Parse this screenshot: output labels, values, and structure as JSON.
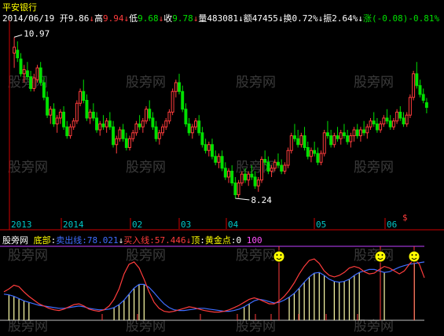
{
  "stock_name": "平安银行",
  "info": {
    "date": "2014/06/19",
    "open_label": "开",
    "open": "9.86",
    "high_label": "高",
    "high": "9.94",
    "low_label": "低",
    "low": "9.68",
    "close_label": "收",
    "close": "9.78",
    "vol_label": "量",
    "vol": "483081",
    "amt_label": "额",
    "amt": "47455",
    "turnover_label": "换",
    "turnover": "0.72%",
    "amp_label": "振",
    "amp": "2.64%",
    "change_label": "涨",
    "change": "(-0.08)",
    "change_pct": "-0.81%"
  },
  "annotations": {
    "max_price": "10.97",
    "min_price": "8.24",
    "marker": "$"
  },
  "time_labels": [
    "2013",
    "2014",
    "02",
    "03",
    "04",
    "05",
    "06"
  ],
  "watermark": "股旁网",
  "indicator": {
    "name": "股旁网",
    "bottom_label": "底部",
    "sell_label": "卖出线",
    "sell_value": "78.021",
    "buy_label": "买入线",
    "buy_value": "57.446",
    "top_label": "顶",
    "gold_label": "黄金点",
    "gold_value": "0",
    "hundred": "100"
  },
  "colors": {
    "up": "#ff3c3c",
    "down": "#00e000",
    "axis": "#d00000",
    "grid": "#7a0000",
    "sell": "#3f6dff",
    "buy": "#ff3c3c"
  },
  "chart_data": [
    {
      "type": "candlestick",
      "title": "平安银行",
      "x_labels": [
        "2013",
        "2014",
        "02",
        "03",
        "04",
        "05",
        "06"
      ],
      "annotations": [
        {
          "label": "10.97",
          "kind": "high"
        },
        {
          "label": "8.24",
          "kind": "low"
        }
      ],
      "ylim": [
        8.0,
        11.2
      ],
      "candles": [
        [
          10.7,
          10.97,
          10.45,
          10.8
        ],
        [
          10.75,
          10.9,
          10.55,
          10.62
        ],
        [
          10.6,
          10.7,
          10.3,
          10.35
        ],
        [
          10.35,
          10.5,
          10.2,
          10.42
        ],
        [
          10.4,
          10.55,
          10.25,
          10.3
        ],
        [
          10.3,
          10.4,
          10.05,
          10.1
        ],
        [
          10.1,
          10.35,
          10.05,
          10.28
        ],
        [
          10.25,
          10.5,
          10.2,
          10.45
        ],
        [
          10.45,
          10.55,
          10.15,
          10.2
        ],
        [
          10.2,
          10.3,
          9.9,
          9.95
        ],
        [
          9.95,
          10.05,
          9.6,
          9.65
        ],
        [
          9.65,
          9.8,
          9.5,
          9.75
        ],
        [
          9.75,
          9.85,
          9.45,
          9.5
        ],
        [
          9.5,
          9.65,
          9.35,
          9.6
        ],
        [
          9.6,
          9.75,
          9.5,
          9.7
        ],
        [
          9.7,
          9.8,
          9.4,
          9.45
        ],
        [
          9.45,
          9.55,
          9.25,
          9.3
        ],
        [
          9.3,
          9.5,
          9.25,
          9.45
        ],
        [
          9.45,
          9.6,
          9.4,
          9.55
        ],
        [
          9.55,
          9.9,
          9.5,
          9.85
        ],
        [
          9.85,
          10.1,
          9.8,
          10.05
        ],
        [
          10.05,
          10.25,
          9.85,
          9.9
        ],
        [
          9.9,
          10.0,
          9.55,
          9.6
        ],
        [
          9.6,
          9.75,
          9.5,
          9.7
        ],
        [
          9.7,
          9.85,
          9.55,
          9.6
        ],
        [
          9.6,
          9.7,
          9.35,
          9.4
        ],
        [
          9.4,
          9.55,
          9.3,
          9.5
        ],
        [
          9.5,
          9.65,
          9.4,
          9.45
        ],
        [
          9.45,
          9.6,
          9.35,
          9.55
        ],
        [
          9.55,
          9.7,
          9.4,
          9.45
        ],
        [
          9.45,
          9.55,
          9.1,
          9.15
        ],
        [
          9.15,
          9.3,
          9.0,
          9.25
        ],
        [
          9.25,
          9.45,
          9.2,
          9.4
        ],
        [
          9.4,
          9.5,
          9.2,
          9.25
        ],
        [
          9.25,
          9.35,
          9.05,
          9.1
        ],
        [
          9.1,
          9.3,
          9.05,
          9.25
        ],
        [
          9.25,
          9.4,
          9.2,
          9.35
        ],
        [
          9.35,
          9.55,
          9.3,
          9.5
        ],
        [
          9.5,
          9.65,
          9.4,
          9.45
        ],
        [
          9.45,
          9.6,
          9.35,
          9.55
        ],
        [
          9.55,
          9.8,
          9.5,
          9.75
        ],
        [
          9.75,
          9.9,
          9.55,
          9.6
        ],
        [
          9.6,
          9.7,
          9.4,
          9.45
        ],
        [
          9.45,
          9.55,
          9.2,
          9.25
        ],
        [
          9.25,
          9.4,
          9.15,
          9.35
        ],
        [
          9.35,
          9.5,
          9.3,
          9.45
        ],
        [
          9.45,
          9.6,
          9.4,
          9.55
        ],
        [
          9.55,
          9.75,
          9.5,
          9.7
        ],
        [
          9.7,
          10.1,
          9.65,
          10.05
        ],
        [
          10.05,
          10.25,
          9.95,
          10.2
        ],
        [
          10.2,
          10.35,
          10.0,
          10.05
        ],
        [
          10.05,
          10.15,
          9.7,
          9.75
        ],
        [
          9.75,
          9.85,
          9.45,
          9.5
        ],
        [
          9.5,
          9.6,
          9.3,
          9.35
        ],
        [
          9.35,
          9.5,
          9.25,
          9.45
        ],
        [
          9.45,
          9.6,
          9.4,
          9.55
        ],
        [
          9.55,
          9.65,
          9.3,
          9.35
        ],
        [
          9.35,
          9.45,
          9.1,
          9.15
        ],
        [
          9.15,
          9.25,
          9.0,
          9.05
        ],
        [
          9.05,
          9.2,
          8.95,
          9.15
        ],
        [
          9.15,
          9.25,
          8.9,
          8.95
        ],
        [
          8.95,
          9.05,
          8.8,
          8.85
        ],
        [
          8.85,
          9.0,
          8.75,
          8.95
        ],
        [
          8.95,
          9.05,
          8.7,
          8.75
        ],
        [
          8.75,
          8.85,
          8.55,
          8.6
        ],
        [
          8.6,
          8.75,
          8.5,
          8.7
        ],
        [
          8.7,
          8.8,
          8.45,
          8.5
        ],
        [
          8.5,
          8.6,
          8.24,
          8.3
        ],
        [
          8.3,
          8.55,
          8.25,
          8.5
        ],
        [
          8.5,
          8.7,
          8.45,
          8.65
        ],
        [
          8.65,
          8.75,
          8.5,
          8.55
        ],
        [
          8.55,
          8.7,
          8.45,
          8.65
        ],
        [
          8.65,
          8.8,
          8.55,
          8.6
        ],
        [
          8.6,
          8.7,
          8.4,
          8.45
        ],
        [
          8.45,
          8.6,
          8.35,
          8.55
        ],
        [
          8.55,
          8.95,
          8.5,
          8.9
        ],
        [
          8.9,
          9.05,
          8.8,
          8.85
        ],
        [
          8.85,
          8.95,
          8.65,
          8.7
        ],
        [
          8.7,
          8.8,
          8.6,
          8.75
        ],
        [
          8.75,
          8.9,
          8.7,
          8.85
        ],
        [
          8.85,
          9.0,
          8.75,
          8.8
        ],
        [
          8.8,
          8.9,
          8.65,
          8.7
        ],
        [
          8.7,
          8.85,
          8.65,
          8.8
        ],
        [
          8.8,
          9.1,
          8.75,
          9.05
        ],
        [
          9.05,
          9.35,
          9.0,
          9.3
        ],
        [
          9.3,
          9.5,
          9.2,
          9.25
        ],
        [
          9.25,
          9.4,
          9.1,
          9.15
        ],
        [
          9.15,
          9.35,
          9.1,
          9.3
        ],
        [
          9.3,
          9.45,
          9.05,
          9.1
        ],
        [
          9.1,
          9.2,
          8.9,
          8.95
        ],
        [
          8.95,
          9.1,
          8.85,
          9.05
        ],
        [
          9.05,
          9.2,
          8.95,
          9.0
        ],
        [
          9.0,
          9.1,
          8.8,
          8.85
        ],
        [
          8.85,
          9.05,
          8.8,
          9.0
        ],
        [
          9.0,
          9.4,
          8.95,
          9.35
        ],
        [
          9.35,
          9.55,
          9.25,
          9.3
        ],
        [
          9.3,
          9.4,
          9.1,
          9.15
        ],
        [
          9.15,
          9.35,
          9.1,
          9.3
        ],
        [
          9.3,
          9.45,
          9.2,
          9.25
        ],
        [
          9.25,
          9.4,
          9.15,
          9.35
        ],
        [
          9.35,
          9.5,
          9.25,
          9.3
        ],
        [
          9.3,
          9.4,
          9.15,
          9.2
        ],
        [
          9.2,
          9.35,
          9.1,
          9.3
        ],
        [
          9.3,
          9.45,
          9.2,
          9.4
        ],
        [
          9.4,
          9.5,
          9.25,
          9.3
        ],
        [
          9.3,
          9.45,
          9.2,
          9.4
        ],
        [
          9.4,
          9.55,
          9.3,
          9.35
        ],
        [
          9.35,
          9.5,
          9.25,
          9.45
        ],
        [
          9.45,
          9.6,
          9.4,
          9.55
        ],
        [
          9.55,
          9.7,
          9.45,
          9.5
        ],
        [
          9.5,
          9.6,
          9.35,
          9.4
        ],
        [
          9.4,
          9.55,
          9.35,
          9.5
        ],
        [
          9.5,
          9.65,
          9.45,
          9.6
        ],
        [
          9.6,
          9.75,
          9.5,
          9.55
        ],
        [
          9.55,
          9.65,
          9.4,
          9.45
        ],
        [
          9.45,
          9.6,
          9.4,
          9.55
        ],
        [
          9.55,
          9.75,
          9.5,
          9.7
        ],
        [
          9.7,
          9.8,
          9.55,
          9.6
        ],
        [
          9.6,
          9.7,
          9.45,
          9.5
        ],
        [
          9.5,
          9.7,
          9.45,
          9.65
        ],
        [
          9.65,
          10.0,
          9.6,
          9.95
        ],
        [
          9.95,
          10.4,
          9.9,
          10.35
        ],
        [
          10.35,
          10.55,
          10.1,
          10.15
        ],
        [
          10.15,
          10.25,
          9.95,
          10.0
        ],
        [
          10.0,
          10.1,
          9.85,
          9.9
        ],
        [
          9.86,
          9.94,
          9.68,
          9.78
        ]
      ]
    },
    {
      "type": "line",
      "title": "股旁网",
      "ylim": [
        0,
        100
      ],
      "series": [
        {
          "name": "卖出线",
          "values": [
            35,
            34,
            32,
            29,
            26,
            24,
            22,
            20,
            19,
            18,
            17,
            16,
            16,
            17,
            18,
            19,
            18,
            16,
            15,
            14,
            14,
            15,
            17,
            21,
            27,
            35,
            43,
            48,
            48,
            44,
            37,
            29,
            22,
            17,
            14,
            13,
            13,
            14,
            15,
            16,
            16,
            15,
            14,
            13,
            12,
            12,
            13,
            15,
            18,
            22,
            26,
            28,
            27,
            25,
            23,
            24,
            27,
            31,
            36,
            43,
            51,
            58,
            63,
            64,
            60,
            55,
            52,
            51,
            52,
            55,
            60,
            64,
            66,
            68,
            68,
            66,
            64,
            65,
            68,
            71,
            73,
            75,
            76,
            77,
            78
          ]
        },
        {
          "name": "买入线",
          "values": [
            38,
            42,
            47,
            45,
            38,
            32,
            27,
            22,
            19,
            16,
            14,
            13,
            15,
            18,
            21,
            22,
            19,
            15,
            13,
            12,
            14,
            19,
            28,
            42,
            62,
            75,
            78,
            70,
            55,
            38,
            24,
            16,
            12,
            11,
            12,
            14,
            16,
            18,
            17,
            15,
            13,
            12,
            11,
            11,
            12,
            14,
            17,
            20,
            24,
            28,
            30,
            28,
            25,
            22,
            22,
            26,
            32,
            40,
            50,
            62,
            72,
            80,
            82,
            76,
            66,
            60,
            58,
            60,
            64,
            70,
            72,
            70,
            65,
            62,
            63,
            68,
            72,
            70,
            66,
            62,
            66,
            75,
            82,
            75,
            57
          ]
        }
      ]
    }
  ]
}
